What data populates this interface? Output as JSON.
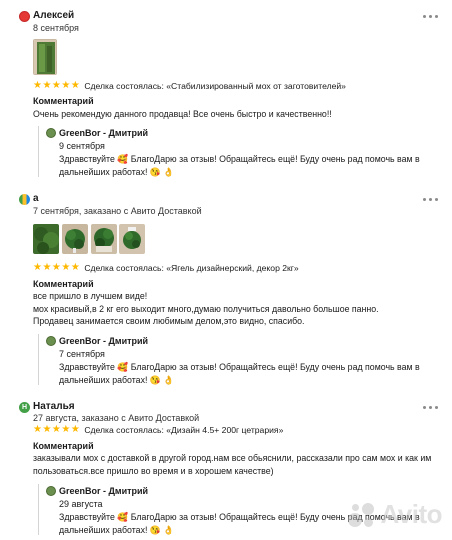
{
  "reviews": [
    {
      "author": "Алексей",
      "avatar_color": "#e53935",
      "meta": "8 сентября",
      "stars": "★★★★★",
      "deal": "Сделка состоялась: «Стабилизированный мох от заготовителей»",
      "comment_title": "Комментарий",
      "comment": "Очень рекомендую данного продавца! Все очень быстро и качественно!!",
      "reply": {
        "author": "GreenBor - Дмитрий",
        "date": "9 сентября",
        "text": "Здравствуйте 🥰 БлагоДарю за отзыв! Обращайтесь ещё! Буду очень рад помочь вам в дальнейших работах! 😘 👌"
      }
    },
    {
      "author": "а",
      "avatar_color": "#4caf50",
      "meta": "7 сентября, заказано с Авито Доставкой",
      "stars": "★★★★★",
      "deal": "Сделка состоялась: «Ягель дизайнерский, декор 2кг»",
      "comment_title": "Комментарий",
      "comment": "все пришло в лучшем виде!\nмох красивый,в 2 кг его выходит много,думаю получиться давольно большое панно.\nПродавец занимается своим любимым делом,это видно, спасибо.",
      "reply": {
        "author": "GreenBor - Дмитрий",
        "date": "7 сентября",
        "text": "Здравствуйте 🥰 БлагоДарю за отзыв! Обращайтесь ещё! Буду очень рад помочь вам в дальнейших работах! 😘 👌"
      }
    },
    {
      "author": "Наталья",
      "avatar_color": "#43a047",
      "avatar_letter": "H",
      "meta": "27 августа, заказано с Авито Доставкой",
      "stars": "★★★★★",
      "deal": "Сделка состоялась: «Дизайн 4.5+ 200г цетрария»",
      "comment_title": "Комментарий",
      "comment": "заказывали мох с доставкой в другой город.нам все обьяснили, рассказали про сам мох и как им пользоваться.все пришло во время и в хорошем качестве)",
      "reply": {
        "author": "GreenBor - Дмитрий",
        "date": "29 августа",
        "text": "Здравствуйте 🥰 БлагоДарю за отзыв! Обращайтесь ещё! Буду очень рад помочь вам в дальнейших работах! 😘 👌"
      }
    }
  ],
  "watermark": "Avito",
  "colors": {
    "star": "#ffb800",
    "text": "#1a1a1a"
  }
}
